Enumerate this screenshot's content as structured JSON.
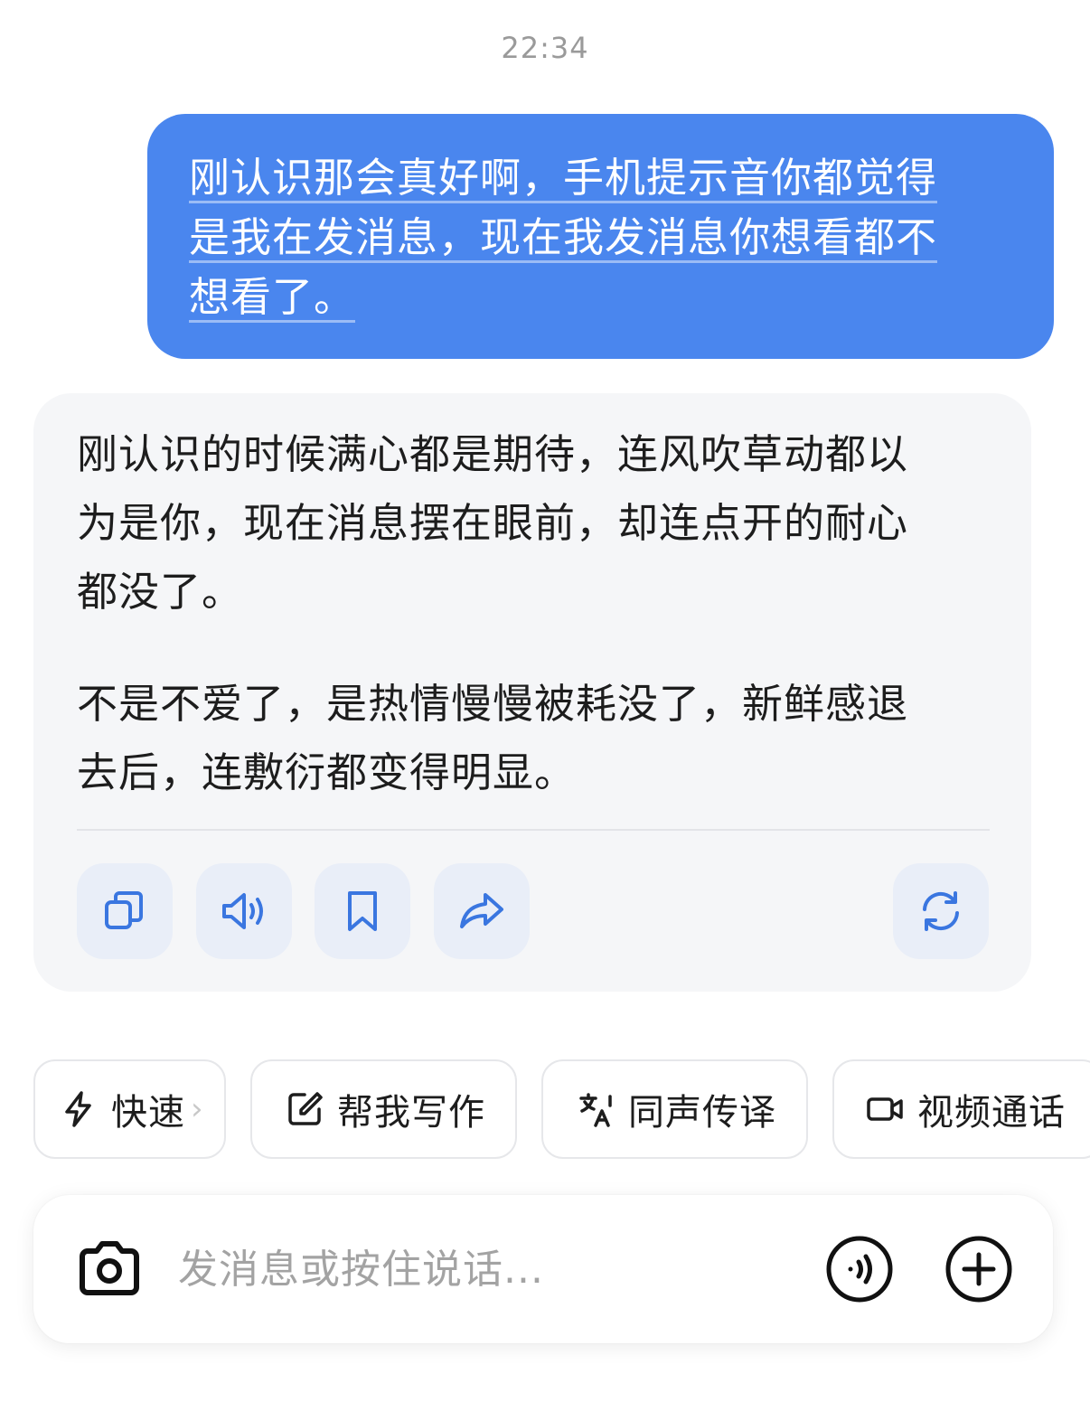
{
  "timestamp": "22:34",
  "user_message": {
    "lines": [
      "刚认识那会真好啊，手机提示音你都觉得",
      "是我在发消息，现在我发消息你想看都不",
      "想看了。"
    ]
  },
  "ai_reply": {
    "paragraph1_lines": [
      "刚认识的时候满心都是期待，连风吹草动都以",
      "为是你，现在消息摆在眼前，却连点开的耐心",
      "都没了。"
    ],
    "paragraph2_lines": [
      "不是不爱了，是热情慢慢被耗没了，新鲜感退",
      "去后，连敷衍都变得明显。"
    ]
  },
  "actions": [
    {
      "name": "copy",
      "icon": "copy-icon"
    },
    {
      "name": "read-aloud",
      "icon": "speaker-icon"
    },
    {
      "name": "save",
      "icon": "bookmark-icon"
    },
    {
      "name": "share",
      "icon": "share-icon"
    },
    {
      "name": "regenerate",
      "icon": "refresh-icon"
    }
  ],
  "quick_chips": [
    {
      "label": "快速",
      "icon": "lightning-icon",
      "has_chevron": true
    },
    {
      "label": "帮我写作",
      "icon": "edit-icon"
    },
    {
      "label": "同声传译",
      "icon": "translate-icon"
    },
    {
      "label": "视频通话",
      "icon": "video-icon"
    }
  ],
  "input": {
    "placeholder": "发消息或按住说话...",
    "value": ""
  },
  "colors": {
    "user_bubble": "#4a86ee",
    "ai_card": "#f5f6f8",
    "action_icon": "#3a76e0",
    "action_bg": "#e9eef8"
  }
}
